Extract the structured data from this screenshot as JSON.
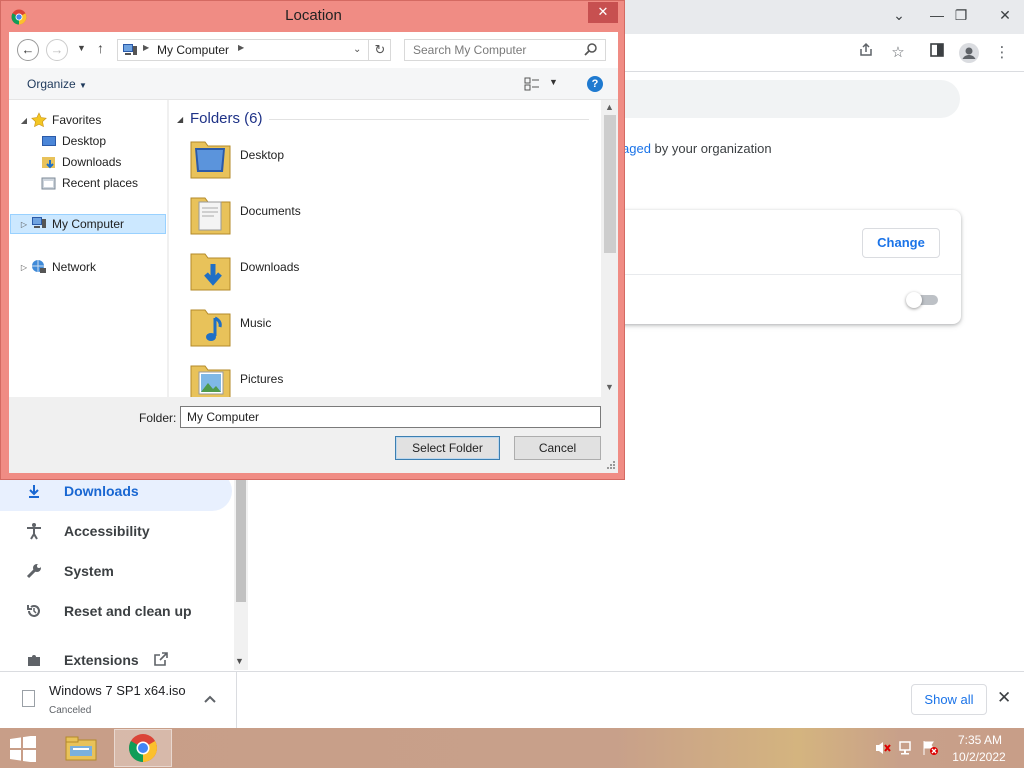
{
  "dialog": {
    "title": "Location",
    "close_glyph": "✕",
    "address": {
      "segment": "My Computer"
    },
    "search_placeholder": "Search My Computer",
    "organize_label": "Organize",
    "help_glyph": "?",
    "tree": {
      "favorites": "Favorites",
      "desktop": "Desktop",
      "downloads": "Downloads",
      "recent": "Recent places",
      "my_computer": "My Computer",
      "network": "Network"
    },
    "group_header": "Folders (6)",
    "folders": [
      "Desktop",
      "Documents",
      "Downloads",
      "Music",
      "Pictures"
    ],
    "folder_label": "Folder:",
    "folder_value": "My Computer",
    "select_button": "Select Folder",
    "cancel_button": "Cancel"
  },
  "chrome": {
    "managed_link": "aged",
    "managed_rest": " by your organization",
    "change_button": "Change",
    "sidebar": [
      {
        "label": "Downloads",
        "icon": "download-icon",
        "active": true
      },
      {
        "label": "Accessibility",
        "icon": "accessibility-icon",
        "active": false
      },
      {
        "label": "System",
        "icon": "wrench-icon",
        "active": false
      },
      {
        "label": "Reset and clean up",
        "icon": "reset-icon",
        "active": false
      },
      {
        "label": "Extensions",
        "icon": "puzzle-icon",
        "active": false
      }
    ]
  },
  "shelf": {
    "file_name": "Windows 7 SP1 x64.iso",
    "status": "Canceled",
    "show_all": "Show all"
  },
  "taskbar": {
    "time": "7:35 AM",
    "date": "10/2/2022"
  },
  "colors": {
    "dialog_frame": "#f08c84",
    "chrome_accent": "#1a73e8",
    "taskbar": "#c89e88"
  }
}
